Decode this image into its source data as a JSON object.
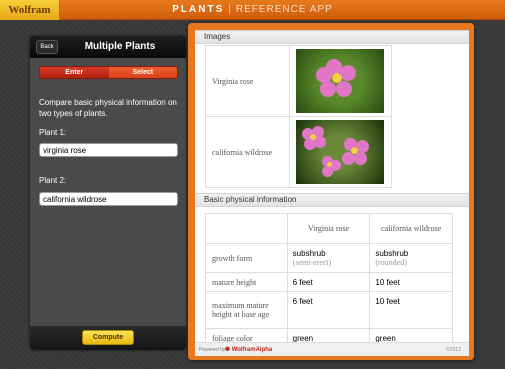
{
  "header": {
    "brand": "Wolfram",
    "app_name": "PLANTS",
    "separator": "|",
    "app_subtitle": "REFERENCE APP"
  },
  "left_panel": {
    "back_label": "Back",
    "title": "Multiple Plants",
    "mode_tabs": [
      {
        "label": "Enter",
        "selected": false
      },
      {
        "label": "Select",
        "selected": true
      }
    ],
    "description": "Compare basic physical information on two types of plants.",
    "plant1": {
      "label": "Plant 1:",
      "value": "virginia rose"
    },
    "plant2": {
      "label": "Plant 2:",
      "value": "california wildrose"
    },
    "compute_label": "Compute"
  },
  "right_panel": {
    "images_section_title": "Images",
    "images": [
      {
        "name": "Virginia rose",
        "icon": "virginia-rose-photo"
      },
      {
        "name": "california wildrose",
        "icon": "california-wildrose-photo"
      }
    ],
    "basic_section_title": "Basic physical information",
    "table": {
      "columns": [
        "",
        "Virginia rose",
        "california wildrose"
      ],
      "rows": [
        {
          "label": "growth form",
          "v1": "subshrub",
          "v1_sub": "(semi-erect)",
          "v2": "subshrub",
          "v2_sub": "(rounded)"
        },
        {
          "label": "mature height",
          "v1_num": "6",
          "v1_unit": "feet",
          "v2_num": "10",
          "v2_unit": "feet"
        },
        {
          "label": "maximum mature height at base age",
          "v1_num": "6",
          "v1_unit": "feet",
          "v2_num": "10",
          "v2_unit": "feet"
        },
        {
          "label": "foliage color",
          "v1": "green",
          "v2": "green"
        }
      ]
    },
    "footer": {
      "powered_by": "Powered by",
      "wolfram_alpha": "WolframAlpha",
      "copyright": "©2013"
    }
  },
  "colors": {
    "accent_orange": "#e8781e",
    "compute_yellow": "#fde25a",
    "segment_red": "#d83a2a",
    "flower_pink": "#e276c6"
  }
}
